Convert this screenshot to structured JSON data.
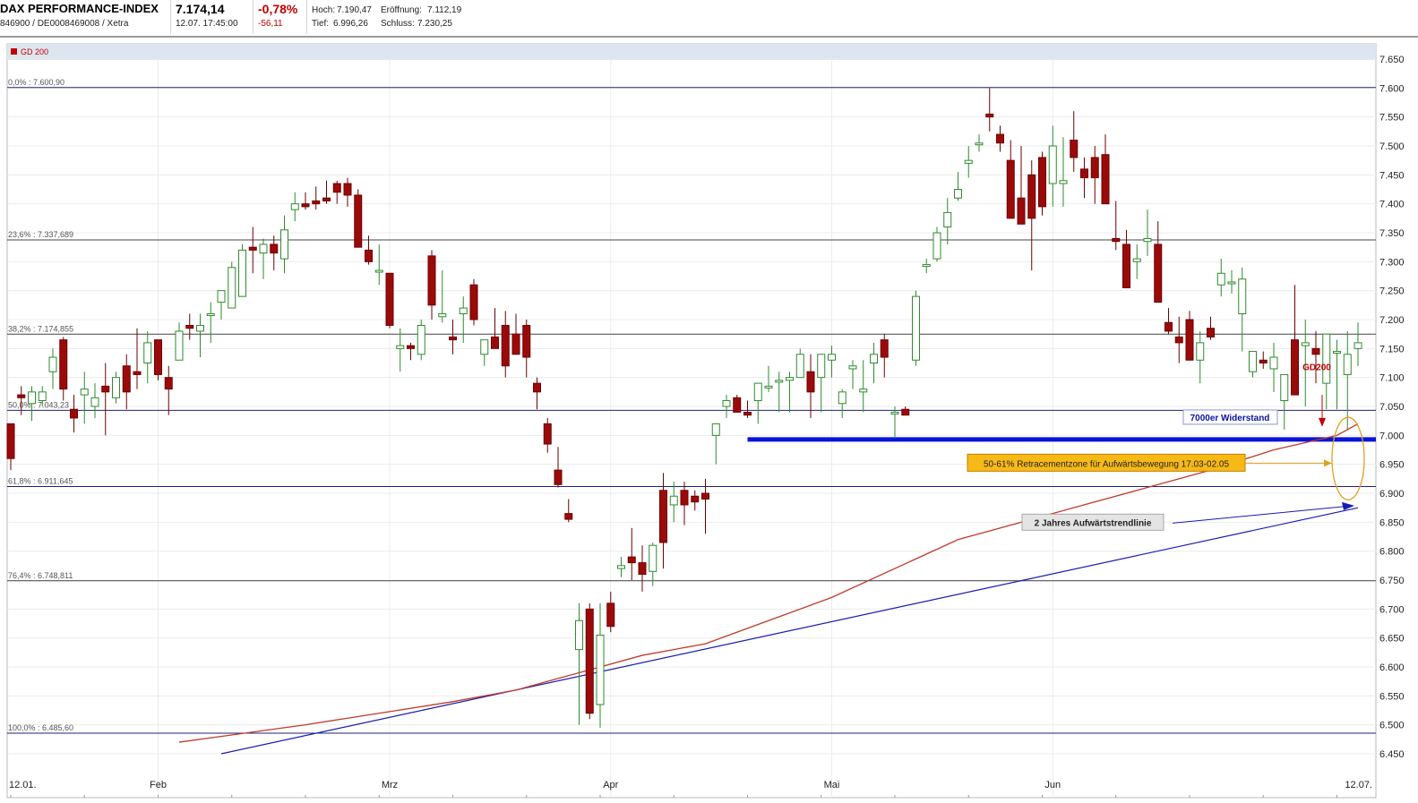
{
  "quote": {
    "name": "DAX PERFORMANCE-INDEX",
    "ids": "846900 / DE0008469008 / Xetra",
    "price": "7.174,14",
    "time": "12.07. 17:45:00",
    "change_pct": "-0,78%",
    "change_abs": "-56,11",
    "high_label": "Hoch:",
    "high": "7.190,47",
    "low_label": "Tief:",
    "low": "6.996,26",
    "open_label": "Eröffnung:",
    "open": "7.112,19",
    "close_label": "Schluss:",
    "close": "7.230,25"
  },
  "legend": {
    "label": "GD 200",
    "color": "#c00000"
  },
  "colors": {
    "up": "#2e8b2e",
    "down": "#9b0a0a",
    "gd200": "#c0392b",
    "trend": "#1a1ab0",
    "fibo": "#20207a",
    "support": "#0a14d8",
    "oval": "#e0a020",
    "callout_bg": "#f7b916"
  },
  "chart_data": {
    "type": "candlestick",
    "ylim": [
      6450,
      7650
    ],
    "yticks": [
      "6.450",
      "6.500",
      "6.550",
      "6.600",
      "6.650",
      "6.700",
      "6.750",
      "6.800",
      "6.850",
      "6.900",
      "6.950",
      "7.000",
      "7.050",
      "7.100",
      "7.150",
      "7.200",
      "7.250",
      "7.300",
      "7.350",
      "7.400",
      "7.450",
      "7.500",
      "7.550",
      "7.600",
      "7.650"
    ],
    "ytick_values": [
      6450,
      6500,
      6550,
      6600,
      6650,
      6700,
      6750,
      6800,
      6850,
      6900,
      6950,
      7000,
      7050,
      7100,
      7150,
      7200,
      7250,
      7300,
      7350,
      7400,
      7450,
      7500,
      7550,
      7600,
      7650
    ],
    "x_labels": [
      "12.01.",
      "Feb",
      "Mrz",
      "Apr",
      "Mai",
      "Jun",
      "12.07."
    ],
    "x_label_days": [
      0,
      14,
      36,
      57,
      78,
      99,
      128
    ],
    "days": 129,
    "candles": [
      [
        0,
        7020,
        7020,
        6940,
        6960
      ],
      [
        1,
        7070,
        7085,
        7035,
        7065
      ],
      [
        2,
        7055,
        7085,
        7025,
        7075
      ],
      [
        3,
        7060,
        7085,
        7050,
        7075
      ],
      [
        4,
        7110,
        7150,
        7080,
        7135
      ],
      [
        5,
        7165,
        7170,
        7060,
        7080
      ],
      [
        6,
        7045,
        7070,
        7005,
        7030
      ],
      [
        7,
        7070,
        7110,
        7020,
        7080
      ],
      [
        8,
        7050,
        7090,
        7030,
        7065
      ],
      [
        9,
        7085,
        7125,
        7000,
        7075
      ],
      [
        10,
        7065,
        7110,
        7055,
        7100
      ],
      [
        11,
        7120,
        7140,
        7045,
        7075
      ],
      [
        12,
        7110,
        7185,
        7080,
        7105
      ],
      [
        13,
        7125,
        7180,
        7090,
        7160
      ],
      [
        14,
        7165,
        7165,
        7095,
        7105
      ],
      [
        15,
        7100,
        7120,
        7035,
        7080
      ],
      [
        16,
        7130,
        7195,
        7130,
        7180
      ],
      [
        17,
        7190,
        7210,
        7165,
        7185
      ],
      [
        18,
        7180,
        7210,
        7135,
        7190
      ],
      [
        19,
        7210,
        7230,
        7160,
        7210
      ],
      [
        20,
        7230,
        7250,
        7200,
        7250
      ],
      [
        21,
        7220,
        7300,
        7220,
        7290
      ],
      [
        22,
        7240,
        7330,
        7240,
        7320
      ],
      [
        23,
        7325,
        7360,
        7280,
        7320
      ],
      [
        24,
        7315,
        7340,
        7270,
        7330
      ],
      [
        25,
        7330,
        7345,
        7285,
        7315
      ],
      [
        26,
        7305,
        7380,
        7280,
        7355
      ],
      [
        27,
        7390,
        7420,
        7370,
        7400
      ],
      [
        28,
        7400,
        7420,
        7390,
        7395
      ],
      [
        29,
        7405,
        7430,
        7390,
        7400
      ],
      [
        30,
        7410,
        7440,
        7400,
        7405
      ],
      [
        31,
        7435,
        7440,
        7400,
        7420
      ],
      [
        32,
        7435,
        7445,
        7395,
        7415
      ],
      [
        33,
        7415,
        7425,
        7340,
        7325
      ],
      [
        34,
        7320,
        7345,
        7295,
        7300
      ],
      [
        35,
        7285,
        7330,
        7260,
        7285
      ],
      [
        36,
        7280,
        7280,
        7185,
        7190
      ],
      [
        37,
        7150,
        7185,
        7110,
        7155
      ],
      [
        38,
        7155,
        7160,
        7130,
        7150
      ],
      [
        39,
        7140,
        7200,
        7130,
        7190
      ],
      [
        40,
        7310,
        7320,
        7200,
        7225
      ],
      [
        41,
        7205,
        7285,
        7195,
        7210
      ],
      [
        42,
        7170,
        7200,
        7140,
        7165
      ],
      [
        43,
        7210,
        7240,
        7160,
        7220
      ],
      [
        44,
        7260,
        7270,
        7190,
        7200
      ],
      [
        45,
        7140,
        7160,
        7120,
        7165
      ],
      [
        46,
        7170,
        7220,
        7150,
        7150
      ],
      [
        47,
        7190,
        7215,
        7100,
        7120
      ],
      [
        48,
        7175,
        7210,
        7150,
        7140
      ],
      [
        49,
        7190,
        7200,
        7100,
        7135
      ],
      [
        50,
        7090,
        7100,
        7045,
        7075
      ],
      [
        51,
        7020,
        7030,
        6970,
        6985
      ],
      [
        52,
        6940,
        6980,
        6910,
        6915
      ],
      [
        53,
        6865,
        6890,
        6850,
        6855
      ],
      [
        54,
        6630,
        6710,
        6500,
        6680
      ],
      [
        55,
        6700,
        6710,
        6510,
        6520
      ],
      [
        56,
        6535,
        6710,
        6495,
        6655
      ],
      [
        57,
        6710,
        6730,
        6660,
        6670
      ],
      [
        58,
        6770,
        6790,
        6755,
        6775
      ],
      [
        59,
        6790,
        6840,
        6750,
        6780
      ],
      [
        60,
        6780,
        6810,
        6730,
        6760
      ],
      [
        61,
        6765,
        6815,
        6740,
        6810
      ],
      [
        62,
        6905,
        6935,
        6770,
        6815
      ],
      [
        63,
        6880,
        6920,
        6850,
        6895
      ],
      [
        64,
        6905,
        6920,
        6845,
        6880
      ],
      [
        65,
        6895,
        6905,
        6870,
        6885
      ],
      [
        66,
        6900,
        6925,
        6830,
        6890
      ],
      [
        67,
        7000,
        7020,
        6950,
        7020
      ],
      [
        68,
        7050,
        7070,
        7030,
        7060
      ],
      [
        69,
        7065,
        7070,
        7040,
        7040
      ],
      [
        70,
        7040,
        7060,
        7030,
        7035
      ],
      [
        71,
        7060,
        7080,
        7020,
        7090
      ],
      [
        72,
        7085,
        7120,
        7075,
        7085
      ],
      [
        73,
        7095,
        7110,
        7040,
        7095
      ],
      [
        74,
        7095,
        7110,
        7040,
        7100
      ],
      [
        75,
        7100,
        7150,
        7100,
        7140
      ],
      [
        76,
        7110,
        7140,
        7030,
        7075
      ],
      [
        77,
        7100,
        7125,
        7040,
        7140
      ],
      [
        78,
        7130,
        7155,
        7100,
        7140
      ],
      [
        79,
        7055,
        7080,
        7030,
        7075
      ],
      [
        80,
        7115,
        7130,
        7080,
        7120
      ],
      [
        81,
        7075,
        7130,
        7040,
        7080
      ],
      [
        82,
        7125,
        7160,
        7090,
        7140
      ],
      [
        83,
        7165,
        7175,
        7100,
        7135
      ],
      [
        84,
        7040,
        7050,
        6995,
        7040
      ],
      [
        85,
        7045,
        7050,
        7040,
        7035
      ],
      [
        86,
        7130,
        7250,
        7120,
        7240
      ],
      [
        87,
        7295,
        7305,
        7280,
        7295
      ],
      [
        88,
        7305,
        7360,
        7300,
        7350
      ],
      [
        89,
        7360,
        7410,
        7330,
        7385
      ],
      [
        90,
        7410,
        7455,
        7405,
        7425
      ],
      [
        91,
        7470,
        7500,
        7445,
        7475
      ],
      [
        92,
        7505,
        7520,
        7490,
        7505
      ],
      [
        93,
        7555,
        7600,
        7525,
        7550
      ],
      [
        94,
        7520,
        7535,
        7490,
        7505
      ],
      [
        95,
        7475,
        7510,
        7380,
        7375
      ],
      [
        96,
        7410,
        7500,
        7365,
        7365
      ],
      [
        97,
        7450,
        7475,
        7285,
        7375
      ],
      [
        98,
        7480,
        7490,
        7380,
        7395
      ],
      [
        99,
        7435,
        7535,
        7395,
        7500
      ],
      [
        100,
        7435,
        7515,
        7395,
        7440
      ],
      [
        101,
        7510,
        7560,
        7455,
        7480
      ],
      [
        102,
        7460,
        7480,
        7410,
        7445
      ],
      [
        103,
        7480,
        7500,
        7400,
        7445
      ],
      [
        104,
        7485,
        7520,
        7410,
        7400
      ],
      [
        105,
        7340,
        7405,
        7320,
        7335
      ],
      [
        106,
        7330,
        7355,
        7265,
        7255
      ],
      [
        107,
        7300,
        7330,
        7270,
        7305
      ],
      [
        108,
        7335,
        7390,
        7310,
        7340
      ],
      [
        109,
        7330,
        7370,
        7240,
        7230
      ],
      [
        110,
        7195,
        7220,
        7175,
        7180
      ],
      [
        111,
        7170,
        7205,
        7125,
        7160
      ],
      [
        112,
        7200,
        7215,
        7140,
        7130
      ],
      [
        113,
        7130,
        7180,
        7090,
        7160
      ],
      [
        114,
        7185,
        7205,
        7165,
        7170
      ],
      [
        115,
        7260,
        7305,
        7240,
        7280
      ],
      [
        116,
        7265,
        7285,
        7245,
        7265
      ],
      [
        117,
        7210,
        7290,
        7145,
        7270
      ],
      [
        118,
        7110,
        7140,
        7100,
        7145
      ],
      [
        119,
        7130,
        7145,
        7115,
        7125
      ],
      [
        120,
        7115,
        7160,
        7075,
        7135
      ],
      [
        121,
        7060,
        7075,
        7010,
        7105
      ],
      [
        122,
        7165,
        7260,
        7070,
        7070
      ],
      [
        123,
        7155,
        7200,
        7050,
        7160
      ],
      [
        124,
        7150,
        7180,
        7090,
        7140
      ],
      [
        125,
        7090,
        7135,
        7045,
        7175
      ],
      [
        126,
        7145,
        7165,
        7045,
        7145
      ],
      [
        127,
        7105,
        7180,
        7010,
        7140
      ],
      [
        128,
        7150,
        7195,
        7120,
        7160
      ]
    ],
    "gd200": [
      [
        16,
        6470
      ],
      [
        28,
        6500
      ],
      [
        35,
        6520
      ],
      [
        42,
        6540
      ],
      [
        48,
        6560
      ],
      [
        54,
        6590
      ],
      [
        60,
        6620
      ],
      [
        66,
        6640
      ],
      [
        72,
        6680
      ],
      [
        78,
        6720
      ],
      [
        84,
        6770
      ],
      [
        90,
        6820
      ],
      [
        96,
        6850
      ],
      [
        102,
        6880
      ],
      [
        108,
        6910
      ],
      [
        114,
        6940
      ],
      [
        120,
        6975
      ],
      [
        126,
        7000
      ],
      [
        128,
        7020
      ]
    ],
    "trendline": [
      [
        20,
        6450
      ],
      [
        128,
        6875
      ]
    ],
    "fibo": [
      {
        "label": "0,0% : 7.600,90",
        "value": 7600.9
      },
      {
        "label": "23,6% : 7.337,689",
        "value": 7337.689
      },
      {
        "label": "38,2% : 7.174,855",
        "value": 7174.855
      },
      {
        "label": "50,0% : 7.043,23",
        "value": 7043.23
      },
      {
        "label": "61,8% : 6.911,645",
        "value": 6911.645
      },
      {
        "label": "76,4% : 6.748,811",
        "value": 6748.811
      },
      {
        "label": "100,0% : 6.485,60",
        "value": 6485.6
      }
    ],
    "support_level": 6993,
    "annotations": {
      "gd200_label": "GD200",
      "resistance_label": "7000er Widerstand",
      "retracement_label": "50-61% Retracementzone für Aufwärtsbewegung 17.03-02.05",
      "trend_label": "2 Jahres Aufwärtstrendlinie"
    }
  }
}
